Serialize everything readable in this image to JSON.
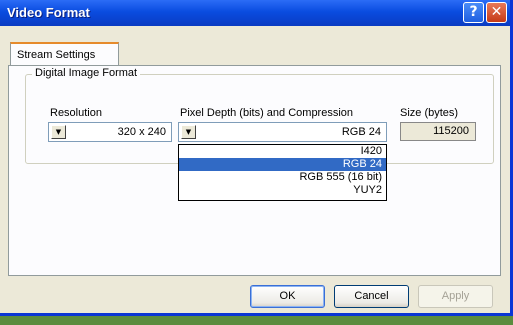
{
  "window": {
    "title": "Video Format"
  },
  "titlebar": {
    "help": "?",
    "close": "✕"
  },
  "tabs": [
    {
      "label": "Stream Settings"
    }
  ],
  "group": {
    "legend": "Digital Image Format",
    "resolution": {
      "label": "Resolution",
      "value": "320 x 240"
    },
    "pixel_depth": {
      "label": "Pixel Depth (bits) and Compression",
      "value": "RGB 24",
      "options": [
        "I420",
        "RGB 24",
        "RGB 555 (16 bit)",
        "YUY2"
      ],
      "selected": "RGB 24"
    },
    "size": {
      "label": "Size (bytes)",
      "value": "115200"
    }
  },
  "buttons": {
    "ok": "OK",
    "cancel": "Cancel",
    "apply": "Apply"
  }
}
